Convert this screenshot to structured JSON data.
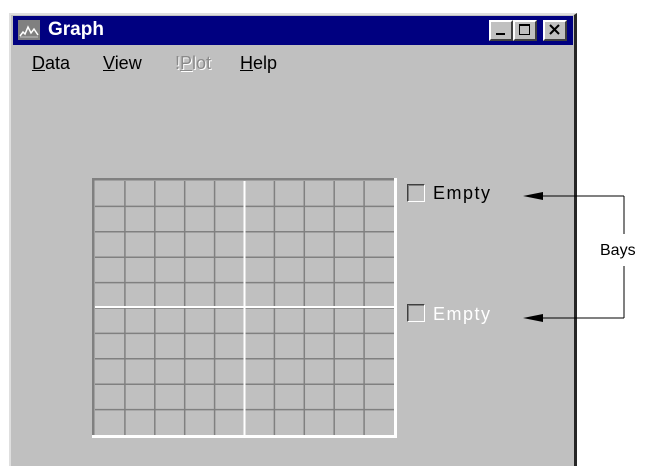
{
  "window": {
    "title": "Graph",
    "controls": [
      "minimize-icon",
      "maximize-icon",
      "close-icon"
    ]
  },
  "menu": {
    "data": {
      "mnemonic": "D",
      "rest": "ata"
    },
    "view": {
      "mnemonic": "V",
      "rest": "iew"
    },
    "plot": {
      "prefix": "!",
      "mnemonic": "P",
      "rest": "lot",
      "disabled": true
    },
    "help": {
      "mnemonic": "H",
      "rest": "elp"
    }
  },
  "bays": [
    {
      "label": "Empty",
      "color": "#000000"
    },
    {
      "label": "Empty",
      "color": "#ffffff"
    }
  ],
  "annotation": {
    "label": "Bays"
  },
  "colors": {
    "titlebar": "#000080",
    "face": "#c0c0c0",
    "grid": "#808080",
    "axis": "#ffffff"
  }
}
